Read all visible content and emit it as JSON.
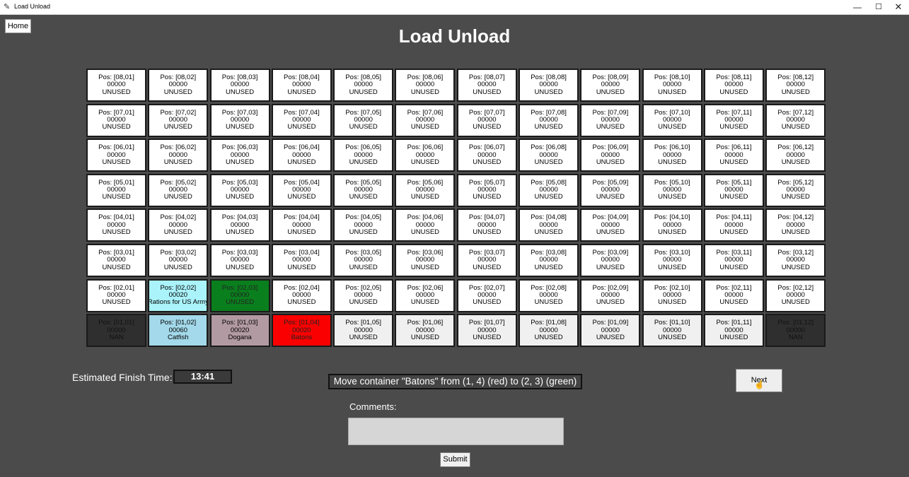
{
  "window": {
    "title": "Load Unload",
    "controls": {
      "minimize": "—",
      "maximize": "☐",
      "close": "✕"
    }
  },
  "header": {
    "home_label": "Home",
    "title": "Load Unload"
  },
  "slots": [
    {
      "text": "Pos: [08,01]\n00000\nUNUSED",
      "style": "normal"
    },
    {
      "text": "Pos: [08,02]\n00000\nUNUSED",
      "style": "normal"
    },
    {
      "text": "Pos: [08,03]\n00000\nUNUSED",
      "style": "normal"
    },
    {
      "text": "Pos: [08,04]\n00000\nUNUSED",
      "style": "normal"
    },
    {
      "text": "Pos: [08,05]\n00000\nUNUSED",
      "style": "normal"
    },
    {
      "text": "Pos: [08,06]\n00000\nUNUSED",
      "style": "normal"
    },
    {
      "text": "Pos: [08,07]\n00000\nUNUSED",
      "style": "normal"
    },
    {
      "text": "Pos: [08,08]\n00000\nUNUSED",
      "style": "normal"
    },
    {
      "text": "Pos: [08,09]\n00000\nUNUSED",
      "style": "normal"
    },
    {
      "text": "Pos: [08,10]\n00000\nUNUSED",
      "style": "normal"
    },
    {
      "text": "Pos: [08,11]\n00000\nUNUSED",
      "style": "normal"
    },
    {
      "text": "Pos: [08,12]\n00000\nUNUSED",
      "style": "normal"
    },
    {
      "text": "Pos: [07,01]\n00000\nUNUSED",
      "style": "normal"
    },
    {
      "text": "Pos: [07,02]\n00000\nUNUSED",
      "style": "normal"
    },
    {
      "text": "Pos: [07,03]\n00000\nUNUSED",
      "style": "normal"
    },
    {
      "text": "Pos: [07,04]\n00000\nUNUSED",
      "style": "normal"
    },
    {
      "text": "Pos: [07,05]\n00000\nUNUSED",
      "style": "normal"
    },
    {
      "text": "Pos: [07,06]\n00000\nUNUSED",
      "style": "normal"
    },
    {
      "text": "Pos: [07,07]\n00000\nUNUSED",
      "style": "normal"
    },
    {
      "text": "Pos: [07,08]\n00000\nUNUSED",
      "style": "normal"
    },
    {
      "text": "Pos: [07,09]\n00000\nUNUSED",
      "style": "normal"
    },
    {
      "text": "Pos: [07,10]\n00000\nUNUSED",
      "style": "normal"
    },
    {
      "text": "Pos: [07,11]\n00000\nUNUSED",
      "style": "normal"
    },
    {
      "text": "Pos: [07,12]\n00000\nUNUSED",
      "style": "normal"
    },
    {
      "text": "Pos: [06,01]\n00000\nUNUSED",
      "style": "normal"
    },
    {
      "text": "Pos: [06,02]\n00000\nUNUSED",
      "style": "normal"
    },
    {
      "text": "Pos: [06,03]\n00000\nUNUSED",
      "style": "normal"
    },
    {
      "text": "Pos: [06,04]\n00000\nUNUSED",
      "style": "normal"
    },
    {
      "text": "Pos: [06,05]\n00000\nUNUSED",
      "style": "normal"
    },
    {
      "text": "Pos: [06,06]\n00000\nUNUSED",
      "style": "normal"
    },
    {
      "text": "Pos: [06,07]\n00000\nUNUSED",
      "style": "normal"
    },
    {
      "text": "Pos: [06,08]\n00000\nUNUSED",
      "style": "normal"
    },
    {
      "text": "Pos: [06,09]\n00000\nUNUSED",
      "style": "normal"
    },
    {
      "text": "Pos: [06,10]\n00000\nUNUSED",
      "style": "normal"
    },
    {
      "text": "Pos: [06,11]\n00000\nUNUSED",
      "style": "normal"
    },
    {
      "text": "Pos: [06,12]\n00000\nUNUSED",
      "style": "normal"
    },
    {
      "text": "Pos: [05,01]\n00000\nUNUSED",
      "style": "normal"
    },
    {
      "text": "Pos: [05,02]\n00000\nUNUSED",
      "style": "normal"
    },
    {
      "text": "Pos: [05,03]\n00000\nUNUSED",
      "style": "normal"
    },
    {
      "text": "Pos: [05,04]\n00000\nUNUSED",
      "style": "normal"
    },
    {
      "text": "Pos: [05,05]\n00000\nUNUSED",
      "style": "normal"
    },
    {
      "text": "Pos: [05,06]\n00000\nUNUSED",
      "style": "normal"
    },
    {
      "text": "Pos: [05,07]\n00000\nUNUSED",
      "style": "normal"
    },
    {
      "text": "Pos: [05,08]\n00000\nUNUSED",
      "style": "normal"
    },
    {
      "text": "Pos: [05,09]\n00000\nUNUSED",
      "style": "normal"
    },
    {
      "text": "Pos: [05,10]\n00000\nUNUSED",
      "style": "normal"
    },
    {
      "text": "Pos: [05,11]\n00000\nUNUSED",
      "style": "normal"
    },
    {
      "text": "Pos: [05,12]\n00000\nUNUSED",
      "style": "normal"
    },
    {
      "text": "Pos: [04,01]\n00000\nUNUSED",
      "style": "normal"
    },
    {
      "text": "Pos: [04,02]\n00000\nUNUSED",
      "style": "normal"
    },
    {
      "text": "Pos: [04,03]\n00000\nUNUSED",
      "style": "normal"
    },
    {
      "text": "Pos: [04,04]\n00000\nUNUSED",
      "style": "normal"
    },
    {
      "text": "Pos: [04,05]\n00000\nUNUSED",
      "style": "normal"
    },
    {
      "text": "Pos: [04,06]\n00000\nUNUSED",
      "style": "normal"
    },
    {
      "text": "Pos: [04,07]\n00000\nUNUSED",
      "style": "normal"
    },
    {
      "text": "Pos: [04,08]\n00000\nUNUSED",
      "style": "normal"
    },
    {
      "text": "Pos: [04,09]\n00000\nUNUSED",
      "style": "normal"
    },
    {
      "text": "Pos: [04,10]\n00000\nUNUSED",
      "style": "normal"
    },
    {
      "text": "Pos: [04,11]\n00000\nUNUSED",
      "style": "normal"
    },
    {
      "text": "Pos: [04,12]\n00000\nUNUSED",
      "style": "normal"
    },
    {
      "text": "Pos: [03,01]\n00000\nUNUSED",
      "style": "normal"
    },
    {
      "text": "Pos: [03,02]\n00000\nUNUSED",
      "style": "normal"
    },
    {
      "text": "Pos: [03,03]\n00000\nUNUSED",
      "style": "normal"
    },
    {
      "text": "Pos: [03,04]\n00000\nUNUSED",
      "style": "normal"
    },
    {
      "text": "Pos: [03,05]\n00000\nUNUSED",
      "style": "normal"
    },
    {
      "text": "Pos: [03,06]\n00000\nUNUSED",
      "style": "normal"
    },
    {
      "text": "Pos: [03,07]\n00000\nUNUSED",
      "style": "normal"
    },
    {
      "text": "Pos: [03,08]\n00000\nUNUSED",
      "style": "normal"
    },
    {
      "text": "Pos: [03,09]\n00000\nUNUSED",
      "style": "normal"
    },
    {
      "text": "Pos: [03,10]\n00000\nUNUSED",
      "style": "normal"
    },
    {
      "text": "Pos: [03,11]\n00000\nUNUSED",
      "style": "normal"
    },
    {
      "text": "Pos: [03,12]\n00000\nUNUSED",
      "style": "normal"
    },
    {
      "text": "Pos: [02,01]\n00000\nUNUSED",
      "style": "normal"
    },
    {
      "text": "Pos: [02,02]\n00020\nRations for US Army",
      "style": "lightcyan"
    },
    {
      "text": "Pos: [02,03]\n00000\nUNUSED",
      "style": "green"
    },
    {
      "text": "Pos: [02,04]\n00000\nUNUSED",
      "style": "normal"
    },
    {
      "text": "Pos: [02,05]\n00000\nUNUSED",
      "style": "normal"
    },
    {
      "text": "Pos: [02,06]\n00000\nUNUSED",
      "style": "normal"
    },
    {
      "text": "Pos: [02,07]\n00000\nUNUSED",
      "style": "normal"
    },
    {
      "text": "Pos: [02,08]\n00000\nUNUSED",
      "style": "normal"
    },
    {
      "text": "Pos: [02,09]\n00000\nUNUSED",
      "style": "normal"
    },
    {
      "text": "Pos: [02,10]\n00000\nUNUSED",
      "style": "normal"
    },
    {
      "text": "Pos: [02,11]\n00000\nUNUSED",
      "style": "normal"
    },
    {
      "text": "Pos: [02,12]\n00000\nUNUSED",
      "style": "normal"
    },
    {
      "text": "Pos: [01,01]\n00000\nNAN",
      "style": "nan"
    },
    {
      "text": "Pos: [01,02]\n00060\nCatfish",
      "style": "skyblue"
    },
    {
      "text": "Pos: [01,03]\n00020\nDogana",
      "style": "pink"
    },
    {
      "text": "Pos: [01,04]\n00020\nBatons",
      "style": "red"
    },
    {
      "text": "Pos: [01,05]\n00000\nUNUSED",
      "style": "bottom"
    },
    {
      "text": "Pos: [01,06]\n00000\nUNUSED",
      "style": "bottom"
    },
    {
      "text": "Pos: [01,07]\n00000\nUNUSED",
      "style": "bottom"
    },
    {
      "text": "Pos: [01,08]\n00000\nUNUSED",
      "style": "bottom"
    },
    {
      "text": "Pos: [01,09]\n00000\nUNUSED",
      "style": "bottom"
    },
    {
      "text": "Pos: [01,10]\n00000\nUNUSED",
      "style": "bottom"
    },
    {
      "text": "Pos: [01,11]\n00000\nUNUSED",
      "style": "bottom"
    },
    {
      "text": "Pos: [01,12]\n00000\nNAN",
      "style": "nan"
    }
  ],
  "status": {
    "eft_label": "Estimated Finish Time:",
    "eft_value": "13:41",
    "instruction": "Move container \"Batons\" from (1, 4) (red) to (2, 3) (green)"
  },
  "actions": {
    "next_label": "Next",
    "comments_label": "Comments:",
    "comments_value": "",
    "submit_label": "Submit"
  },
  "colors": {
    "background": "#4b4b4b",
    "source_highlight": "#fa0000",
    "target_highlight": "#0a7f1d",
    "nan_slot": "#2f2f2f",
    "catfish": "#a3d9ea",
    "rations": "#aaf3fa",
    "dogana": "#b29aa2"
  }
}
